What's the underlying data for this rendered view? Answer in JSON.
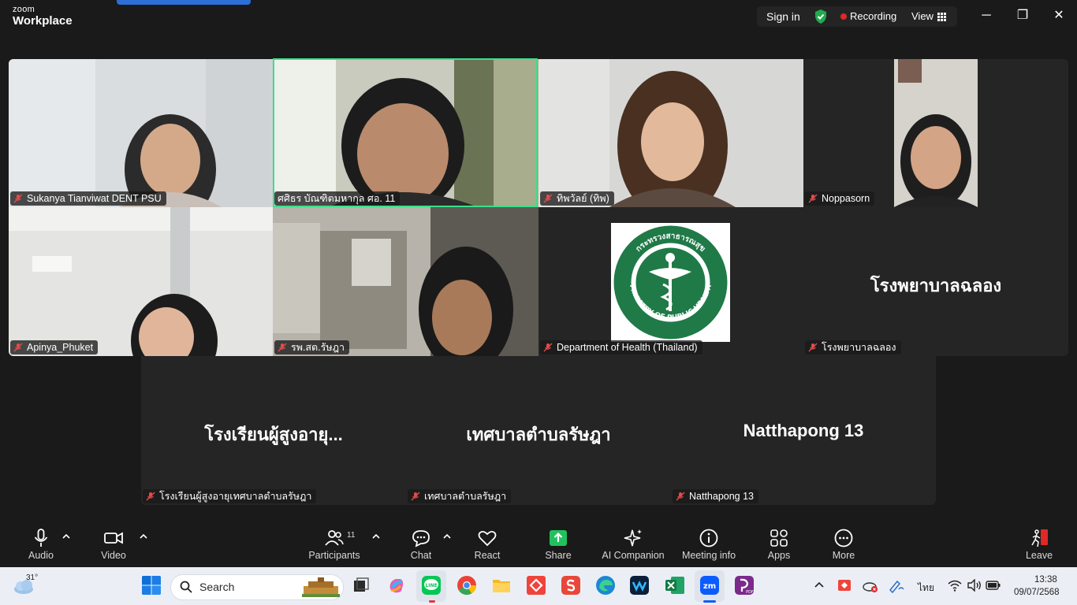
{
  "app": {
    "brand_small": "zoom",
    "brand_big": "Workplace"
  },
  "titlebar": {
    "sign_in": "Sign in",
    "recording": "Recording",
    "view": "View",
    "minimize": "─",
    "restore": "❐",
    "close": "✕",
    "colors": {
      "secure": "#21a94f",
      "recording": "#e02828",
      "active_speaker": "#3be089"
    }
  },
  "participants": [
    {
      "name": "Sukanya Tianviwat DENT PSU"
    },
    {
      "name": "ศศิธร บัณฑิตมหากุล ศอ. 11"
    },
    {
      "name": "ทิพวัลย์ (ทิพ)"
    },
    {
      "name": "Noppasorn"
    },
    {
      "name": "Apinya_Phuket"
    },
    {
      "name": "รพ.สต.รัษฎา"
    },
    {
      "name": "Department of Health (Thailand)",
      "logo_text_top": "กระทรวงสาธารณสุข",
      "logo_text_bottom": "MINISTRY OF PUBLIC HEALTH"
    },
    {
      "name": "โรงพยาบาลฉลอง",
      "display": "โรงพยาบาลฉลอง"
    },
    {
      "name": "โรงเรียนผู้สูงอายุเทศบาลตำบลรัษฎา",
      "display": "โรงเรียนผู้สูงอายุ..."
    },
    {
      "name": "เทศบาลตำบลรัษฎา",
      "display": "เทศบาลตำบลรัษฎา"
    },
    {
      "name": "Natthapong 13",
      "display": "Natthapong 13"
    }
  ],
  "toolbar": {
    "audio": "Audio",
    "video": "Video",
    "participants": "Participants",
    "participant_count": "11",
    "chat": "Chat",
    "react": "React",
    "share": "Share",
    "ai_companion": "AI Companion",
    "meeting_info": "Meeting info",
    "apps": "Apps",
    "more": "More",
    "leave": "Leave"
  },
  "taskbar": {
    "weather_temp": "31°",
    "search_placeholder": "Search",
    "language": "ไทย",
    "time": "13:38",
    "date": "09/07/2568",
    "icons": [
      "weather-icon",
      "start-icon",
      "search-icon",
      "task-view-icon",
      "copilot-icon",
      "line-icon",
      "chrome-icon",
      "file-explorer-icon",
      "anydesk-icon",
      "wps-icon",
      "edge-icon",
      "webex-icon",
      "excel-icon",
      "zoom-icon",
      "pdf-icon"
    ]
  }
}
